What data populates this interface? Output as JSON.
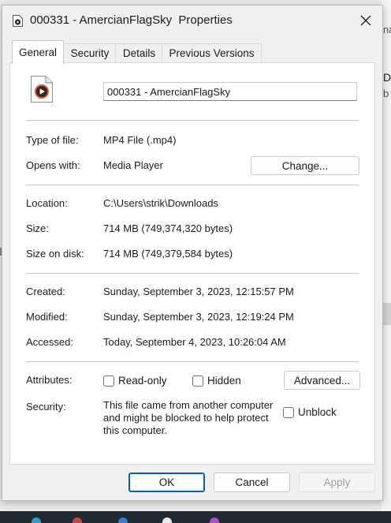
{
  "window": {
    "title": "000331 - AmercianFlagSky  Properties",
    "close_icon": "close-icon"
  },
  "tabs": [
    {
      "label": "General",
      "active": true
    },
    {
      "label": "Security",
      "active": false
    },
    {
      "label": "Details",
      "active": false
    },
    {
      "label": "Previous Versions",
      "active": false
    }
  ],
  "file": {
    "name": "000331 - AmercianFlagSky",
    "icon": "media-player-file-icon"
  },
  "info": {
    "type_label": "Type of file:",
    "type_value": "MP4 File (.mp4)",
    "opens_label": "Opens with:",
    "opens_value": "Media Player",
    "change_button": "Change...",
    "location_label": "Location:",
    "location_value": "C:\\Users\\strik\\Downloads",
    "size_label": "Size:",
    "size_value": "714 MB (749,374,320 bytes)",
    "size_disk_label": "Size on disk:",
    "size_disk_value": "714 MB (749,379,584 bytes)",
    "created_label": "Created:",
    "created_value": "Sunday, September 3, 2023, 12:15:57 PM",
    "modified_label": "Modified:",
    "modified_value": "Sunday, September 3, 2023, 12:19:24 PM",
    "accessed_label": "Accessed:",
    "accessed_value": "Today, September 4, 2023, 10:26:04 AM"
  },
  "attributes": {
    "label": "Attributes:",
    "readonly_label": "Read-only",
    "readonly_checked": false,
    "hidden_label": "Hidden",
    "hidden_checked": false,
    "advanced_button": "Advanced..."
  },
  "security": {
    "label": "Security:",
    "message": "This file came from another computer and might be blocked to help protect this computer.",
    "unblock_label": "Unblock",
    "unblock_checked": false
  },
  "buttons": {
    "ok": "OK",
    "cancel": "Cancel",
    "apply": "Apply"
  },
  "background": {
    "fragment_1": "na",
    "fragment_2": "Du",
    "fragment_3": "b"
  },
  "colors": {
    "accent": "#005fb8",
    "disabled_text": "#9d9d9d",
    "icon_orange": "#e05a1b"
  }
}
